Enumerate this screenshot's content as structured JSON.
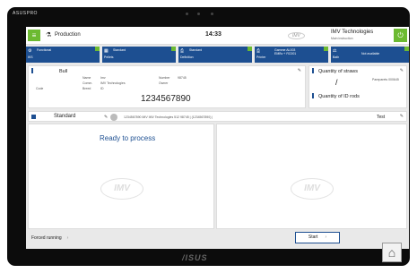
{
  "device": {
    "brand_top": "ASUSPRO",
    "brand_bottom": "/ISUS"
  },
  "topbar": {
    "menu_icon": "hamburger-icon",
    "location_icon": "flask-icon",
    "location": "Production",
    "time": "14:33",
    "brand_logo": "IMV",
    "company": "IMV Technologies",
    "company_sub": "Main instruction",
    "confirm_icon": "power-icon"
  },
  "tiles": [
    {
      "icon": "gear-icon",
      "title": "Functional",
      "sub": "IKS"
    },
    {
      "icon": "grid-icon",
      "title": "Standard",
      "sub": "Pellets"
    },
    {
      "icon": "printer-icon",
      "title": "Standard",
      "sub": "Definition"
    },
    {
      "icon": "printer-icon",
      "title": "Gamme AL003\nEMBv + RC001",
      "sub": "Printer"
    },
    {
      "icon": "scale-icon",
      "title": "Not available",
      "sub": "Bath"
    }
  ],
  "bull": {
    "label": "Bull",
    "code": "1234567890",
    "rows": [
      [
        "Name",
        "Imv",
        "Number",
        "98745"
      ],
      [
        "Comm.",
        "IMV Technologies",
        "Owner",
        ""
      ],
      [
        "Code",
        "Breed",
        "ID",
        ""
      ]
    ]
  },
  "straws": {
    "label": "Quantity of straws",
    "value": "/",
    "note": "Pareparets 000645",
    "rods_label": "Quantity of ID rods"
  },
  "standard": {
    "label": "Standard",
    "line": "1234567890 IMV IMV Technologies 512 98745 | (1234567890) |",
    "right": "Test"
  },
  "status": {
    "ready": "Ready to process"
  },
  "bottom": {
    "forced": "Forced running",
    "start": "Start"
  }
}
